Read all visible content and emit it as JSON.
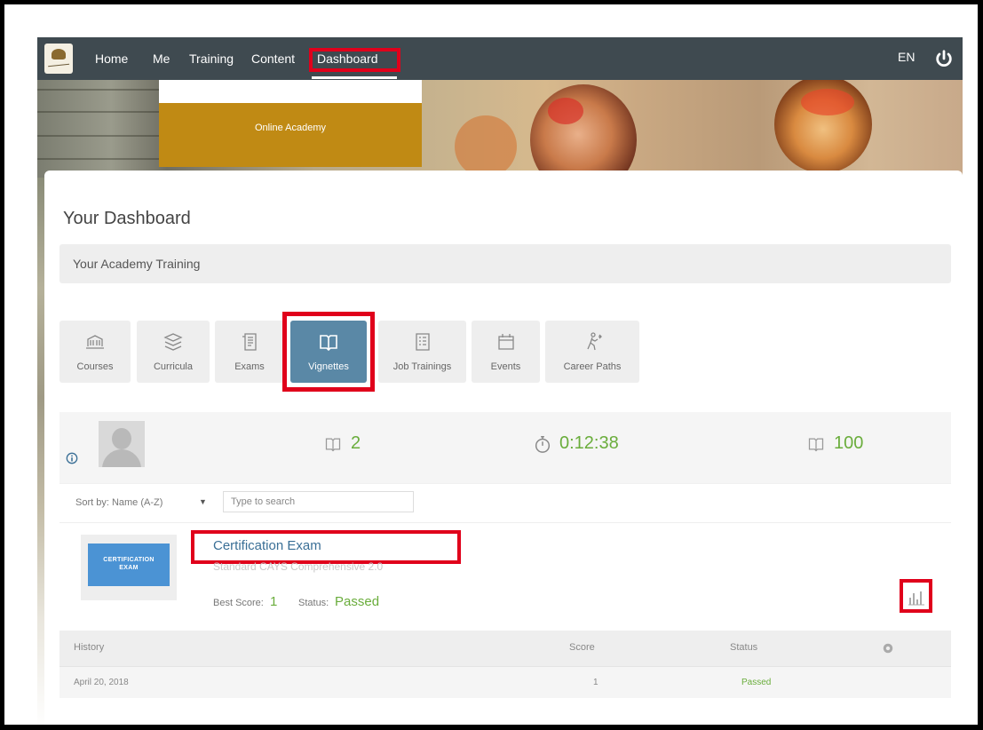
{
  "nav": {
    "items": [
      "Home",
      "Me",
      "Training",
      "Content",
      "Dashboard"
    ],
    "lang": "EN"
  },
  "banner": {
    "academy": "Online Academy"
  },
  "page": {
    "title": "Your Dashboard",
    "section": "Your Academy Training"
  },
  "tabs": [
    {
      "label": "Courses",
      "icon": "courses-icon"
    },
    {
      "label": "Curricula",
      "icon": "curricula-icon"
    },
    {
      "label": "Exams",
      "icon": "exams-icon"
    },
    {
      "label": "Vignettes",
      "icon": "vignettes-icon"
    },
    {
      "label": "Job Trainings",
      "icon": "job-trainings-icon"
    },
    {
      "label": "Events",
      "icon": "events-icon"
    },
    {
      "label": "Career Paths",
      "icon": "career-paths-icon"
    }
  ],
  "stats": {
    "vignettes_count": "2",
    "time_spent": "0:12:38",
    "score_total": "100"
  },
  "sort": {
    "label": "Sort by: Name (A-Z)",
    "search_placeholder": "Type to search"
  },
  "item": {
    "thumb_line1": "CERTIFICATION",
    "thumb_line2": "EXAM",
    "title": "Certification Exam",
    "subtitle": "Standard CAYS Comprehensive 2.0",
    "best_score_label": "Best Score:",
    "best_score": "1",
    "status_label": "Status:",
    "status": "Passed"
  },
  "history": {
    "headers": [
      "History",
      "Score",
      "Status"
    ],
    "rows": [
      {
        "date": "April 20, 2018",
        "score": "1",
        "status": "Passed"
      }
    ]
  },
  "colors": {
    "nav_bg": "#3f4a50",
    "highlight": "#e0001b",
    "accent_green": "#6aad3c",
    "active_tab": "#5a88a6",
    "academy_gold": "#c08a14"
  }
}
